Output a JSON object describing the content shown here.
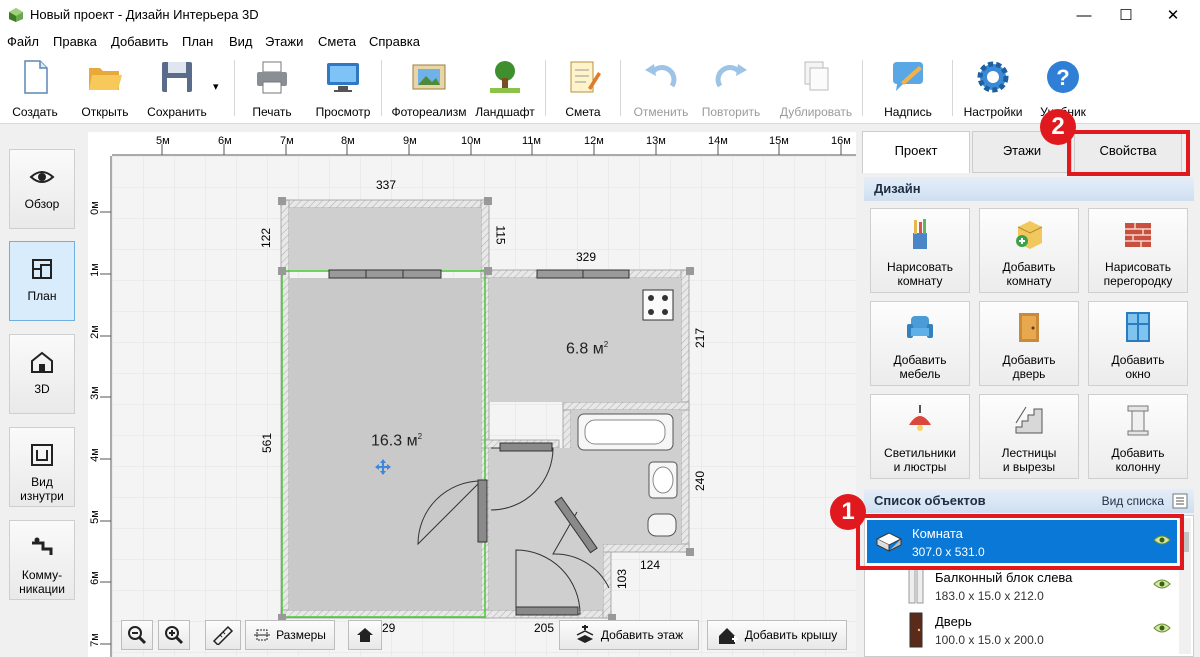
{
  "window": {
    "title": "Новый проект - Дизайн Интерьера 3D",
    "minimize": "—",
    "maximize": "☐",
    "close": "✕"
  },
  "menu": [
    "Файл",
    "Правка",
    "Добавить",
    "План",
    "Вид",
    "Этажи",
    "Смета",
    "Справка"
  ],
  "toolbar": {
    "create": "Создать",
    "open": "Открыть",
    "save": "Сохранить",
    "save_dropdown": "▾",
    "print": "Печать",
    "preview": "Просмотр",
    "photorealism": "Фотореализм",
    "landscape": "Ландшафт",
    "estimate": "Смета",
    "undo": "Отменить",
    "redo": "Повторить",
    "duplicate": "Дублировать",
    "caption": "Надпись",
    "settings": "Настройки",
    "tutorial": "Учебник"
  },
  "nav": {
    "overview": "Обзор",
    "plan": "План",
    "view3d": "3D",
    "inside_line1": "Вид",
    "inside_line2": "изнутри",
    "comm_line1": "Комму-",
    "comm_line2": "никации"
  },
  "ruler": {
    "top_ticks": [
      "5м",
      "6м",
      "7м",
      "8м",
      "9м",
      "10м",
      "11м",
      "12м",
      "13м",
      "14м",
      "15м",
      "16м"
    ],
    "left_ticks": [
      "0м",
      "1м",
      "2м",
      "3м",
      "4м",
      "5м",
      "6м",
      "7м"
    ]
  },
  "plan": {
    "dim_top": "337",
    "dim_left_top": "122",
    "dim_inner_115": "115",
    "dim_329": "329",
    "dim_217": "217",
    "dim_561": "561",
    "dim_240": "240",
    "dim_124": "124",
    "dim_103": "103",
    "dim_205": "205",
    "dim_29": "29",
    "room_big_area": "16.3 м",
    "room_small_area": "6.8 м",
    "sup": "2"
  },
  "bottom": {
    "dimensions": "Размеры",
    "add_floor": "Добавить этаж",
    "add_roof": "Добавить крышу"
  },
  "tabs": {
    "project": "Проект",
    "floors": "Этажи",
    "properties": "Свойства"
  },
  "design": {
    "header": "Дизайн",
    "buttons": [
      {
        "l1": "Нарисовать",
        "l2": "комнату"
      },
      {
        "l1": "Добавить",
        "l2": "комнату"
      },
      {
        "l1": "Нарисовать",
        "l2": "перегородку"
      },
      {
        "l1": "Добавить",
        "l2": "мебель"
      },
      {
        "l1": "Добавить",
        "l2": "дверь"
      },
      {
        "l1": "Добавить",
        "l2": "окно"
      },
      {
        "l1": "Светильники",
        "l2": "и люстры"
      },
      {
        "l1": "Лестницы",
        "l2": "и вырезы"
      },
      {
        "l1": "Добавить",
        "l2": "колонну"
      }
    ]
  },
  "objects": {
    "header": "Список объектов",
    "view_list": "Вид списка",
    "items": [
      {
        "name": "Комната",
        "dims": "307.0 x 531.0"
      },
      {
        "name": "Балконный блок слева",
        "dims": "183.0 x 15.0 x 212.0"
      },
      {
        "name": "Дверь",
        "dims": "100.0 x 15.0 x 200.0"
      }
    ]
  },
  "callouts": {
    "one": "1",
    "two": "2"
  },
  "colors": {
    "accent_red": "#e0191f",
    "selection_blue": "#0a78d7"
  }
}
